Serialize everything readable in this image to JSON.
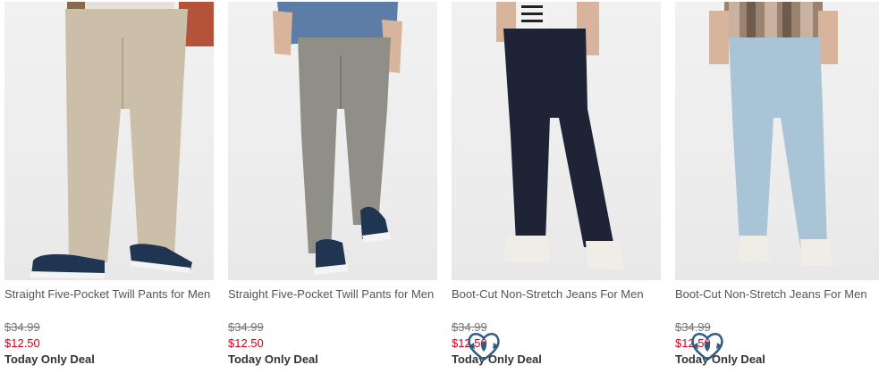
{
  "products": [
    {
      "name": "Straight Five-Pocket Twill Pants for Men",
      "original_price": "$34.99",
      "sale_price": "$12.50",
      "deal_label": "Today Only Deal",
      "pants_color": "#cbbfa9",
      "badge": false
    },
    {
      "name": "Straight Five-Pocket Twill Pants for Men",
      "original_price": "$34.99",
      "sale_price": "$12.50",
      "deal_label": "Today Only Deal",
      "pants_color": "#8f8f88",
      "badge": false
    },
    {
      "name": "Boot-Cut Non-Stretch Jeans For Men",
      "original_price": "$34.99",
      "sale_price": "$12.50",
      "deal_label": "Today Only Deal",
      "pants_color": "#1e2436",
      "badge": true
    },
    {
      "name": "Boot-Cut Non-Stretch Jeans For Men",
      "original_price": "$34.99",
      "sale_price": "$12.50",
      "deal_label": "Today Only Deal",
      "pants_color": "#a8c4d6",
      "badge": true
    }
  ],
  "colors": {
    "sale_price": "#d0021b",
    "badge": "#2f5d86"
  }
}
